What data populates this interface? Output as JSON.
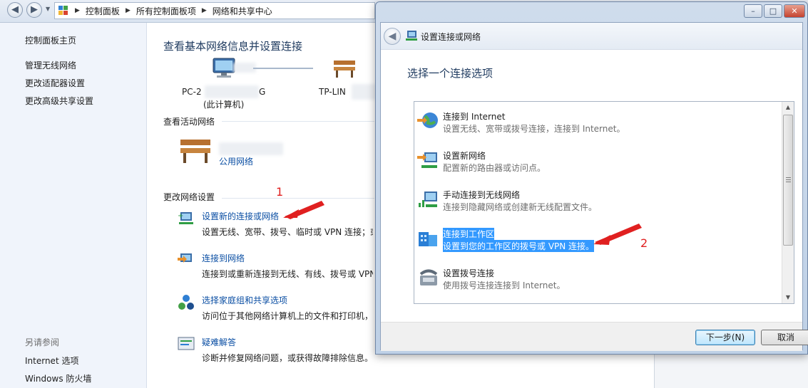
{
  "breadcrumb": [
    "控制面板",
    "所有控制面板项",
    "网络和共享中心"
  ],
  "sidebar": {
    "home": "控制面板主页",
    "links": [
      "管理无线网络",
      "更改适配器设置",
      "更改高级共享设置"
    ],
    "see_also_heading": "另请参阅",
    "see_also": [
      "Internet 选项",
      "Windows 防火墙"
    ]
  },
  "main": {
    "title": "查看基本网络信息并设置连接",
    "computer_label": "PC-2",
    "computer_label_tail": "G",
    "computer_sublabel": "(此计算机)",
    "router_label": "TP-LIN",
    "active_networks_heading": "查看活动网络",
    "network_type": "公用网络",
    "change_settings_heading": "更改网络设置",
    "annotation_1": "1",
    "tasks": [
      {
        "title": "设置新的连接或网络",
        "desc": "设置无线、宽带、拨号、临时或 VPN 连接；或"
      },
      {
        "title": "连接到网络",
        "desc": "连接到或重新连接到无线、有线、拨号或 VPN"
      },
      {
        "title": "选择家庭组和共享选项",
        "desc": "访问位于其他网络计算机上的文件和打印机，"
      },
      {
        "title": "疑难解答",
        "desc": "诊断并修复网络问题，或获得故障排除信息。"
      }
    ]
  },
  "dialog": {
    "caption": "设置连接或网络",
    "heading": "选择一个连接选项",
    "options": [
      {
        "title": "连接到 Internet",
        "desc": "设置无线、宽带或拨号连接，连接到 Internet。",
        "icon": "globe-icon"
      },
      {
        "title": "设置新网络",
        "desc": "配置新的路由器或访问点。",
        "icon": "new-network-icon"
      },
      {
        "title": "手动连接到无线网络",
        "desc": "连接到隐藏网络或创建新无线配置文件。",
        "icon": "wireless-icon"
      },
      {
        "title": "连接到工作区",
        "desc": "设置到您的工作区的拨号或 VPN 连接。",
        "icon": "workplace-icon"
      },
      {
        "title": "设置拨号连接",
        "desc": "使用拨号连接连接到 Internet。",
        "icon": "dialup-phone-icon"
      }
    ],
    "selected_index": 3,
    "annotation_2": "2",
    "next_button": "下一步(N)",
    "cancel_button": "取消"
  },
  "colors": {
    "link": "#0a4ea3",
    "selection": "#3399ff",
    "annotation": "#e02020"
  }
}
